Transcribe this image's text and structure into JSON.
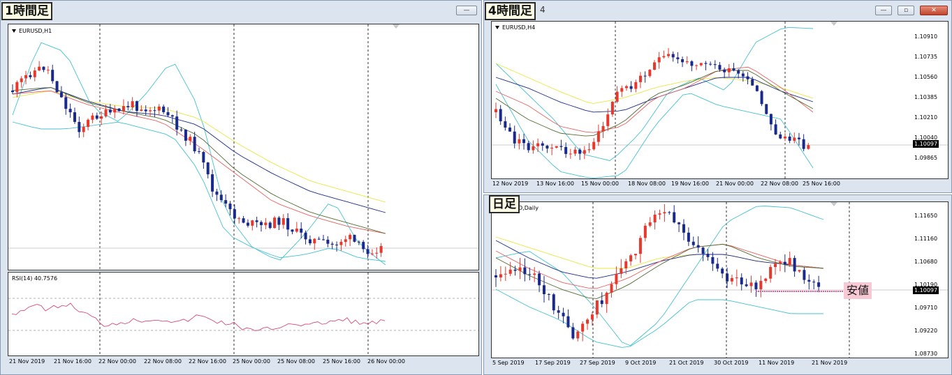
{
  "colors": {
    "bull": "#e8382d",
    "bear": "#1a2a8c",
    "frame": "#dce4ef"
  },
  "h1": {
    "sticker": "1時間足",
    "symbol": "EURUSD,H1",
    "rsi_label": "RSI(14) 40.7576",
    "x_labels": [
      "21 Nov 2019",
      "21 Nov 16:00",
      "22 Nov 00:00",
      "22 Nov 08:00",
      "22 Nov 16:00",
      "25 Nov 00:00",
      "25 Nov 08:00",
      "25 Nov 16:00",
      "26 Nov 00:00"
    ]
  },
  "h4": {
    "sticker": "4時間足",
    "title_suffix": "4",
    "symbol": "EURUSD,H4",
    "price_label": "1.10097",
    "y_labels": [
      "1.10910",
      "1.10735",
      "1.10560",
      "1.10385",
      "1.10210",
      "1.10040",
      "1.09865"
    ],
    "x_labels": [
      "12 Nov 2019",
      "13 Nov 16:00",
      "15 Nov 00:00",
      "18 Nov 08:00",
      "19 Nov 16:00",
      "21 Nov 00:00",
      "22 Nov 08:00",
      "25 Nov 16:00"
    ]
  },
  "d1": {
    "sticker": "日足",
    "symbol": "D,Daily",
    "price_label": "1.10097",
    "note": "安値",
    "y_labels": [
      "1.11650",
      "1.11160",
      "1.10680",
      "1.10190",
      "1.09710",
      "1.09220",
      "1.08730"
    ],
    "x_labels": [
      "5 Sep 2019",
      "17 Sep 2019",
      "27 Sep 2019",
      "9 Oct 2019",
      "21 Oct 2019",
      "30 Oct 2019",
      "11 Nov 2019",
      "21 Nov 2019"
    ]
  }
}
